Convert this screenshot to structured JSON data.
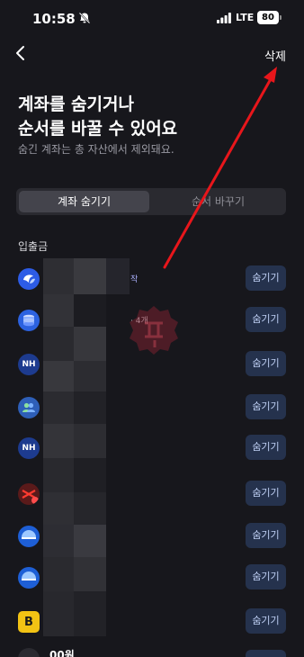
{
  "status": {
    "time": "10:58",
    "network": "LTE",
    "battery": "80"
  },
  "header": {
    "delete_label": "삭제"
  },
  "title": {
    "line1": "계좌를 숨기거나",
    "line2": "순서를 바꿀 수 있어요",
    "subtitle": "숨긴 계좌는 총 자산에서 제외돼요."
  },
  "tabs": [
    {
      "label": "계좌 숨기기",
      "active": true
    },
    {
      "label": "순서 바꾸기",
      "active": false
    }
  ],
  "section": {
    "label": "입출금"
  },
  "accounts": [
    {
      "icon": "toss-bank-icon",
      "text": "작",
      "button": "숨기기"
    },
    {
      "icon": "kakao-bank-coin-icon",
      "text": "· 4개",
      "button": "숨기기"
    },
    {
      "icon": "nh-bank-icon",
      "icon_text": "NH",
      "text": "",
      "button": "숨기기"
    },
    {
      "icon": "people-group-icon",
      "text": "",
      "button": "숨기기"
    },
    {
      "icon": "nh-bank-icon",
      "icon_text": "NH",
      "text": "",
      "button": "숨기기"
    },
    {
      "icon": "red-bank-icon",
      "text": "",
      "button": "숨기기"
    },
    {
      "icon": "blue-bank-icon",
      "text": "",
      "button": "숨기기"
    },
    {
      "icon": "blue-bank-icon",
      "text": "",
      "button": "숨기기"
    },
    {
      "icon": "yellow-b-bank-icon",
      "icon_text": "B",
      "text": "",
      "button": "숨기기"
    }
  ],
  "bottom_partial": {
    "text": "00원"
  },
  "colors": {
    "background": "#17171c",
    "hide_button": "#25324d",
    "arrow": "#e8161b"
  }
}
